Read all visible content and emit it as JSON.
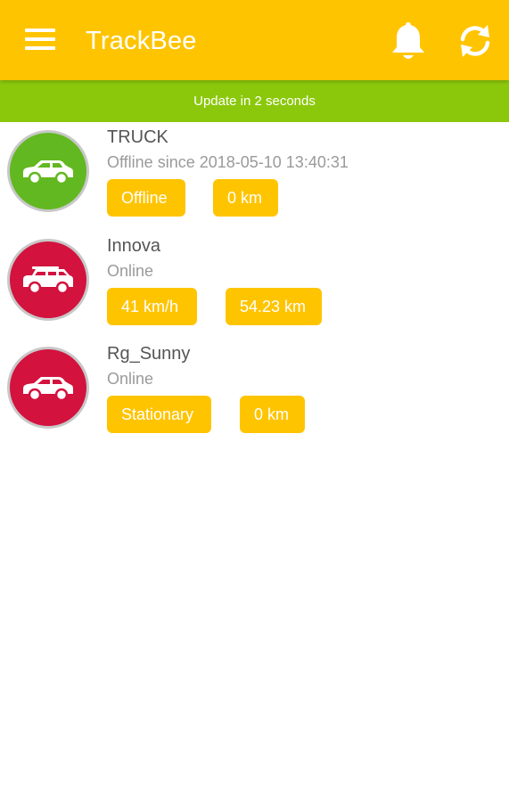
{
  "app": {
    "title": "TrackBee",
    "colors": {
      "header": "#FFC400",
      "status_bar": "#8BC80B",
      "badge": "#FFC400",
      "online_avatar": "#D3123E",
      "offline_avatar": "#62B820"
    },
    "icons": {
      "menu": "menu-icon",
      "notifications": "bell-icon",
      "refresh": "refresh-icon"
    }
  },
  "status_bar": {
    "text": "Update in 2 seconds"
  },
  "vehicles": [
    {
      "name": "TRUCK",
      "status": "Offline since 2018-05-10 13:40:31",
      "badge1": "Offline",
      "badge2": "0 km",
      "state": "offline",
      "icon": "hatchback-car-icon"
    },
    {
      "name": "Innova",
      "status": "Online",
      "badge1": "41 km/h",
      "badge2": "54.23 km",
      "state": "online",
      "icon": "suv-car-icon"
    },
    {
      "name": "Rg_Sunny",
      "status": "Online",
      "badge1": "Stationary",
      "badge2": "0 km",
      "state": "online",
      "icon": "hatchback-car-icon"
    }
  ]
}
